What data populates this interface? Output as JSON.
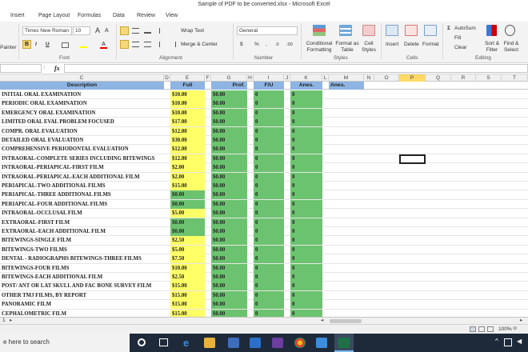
{
  "window": {
    "title": "Sample of PDF to be converted.xlsx  -  Microsoft Excel"
  },
  "menu": [
    "Insert",
    "Page Layout",
    "Formulas",
    "Data",
    "Review",
    "View"
  ],
  "ribbon": {
    "clipboard": {
      "painter": "Painter"
    },
    "font": {
      "name": "Times New Roman",
      "size": "10",
      "label": "Font",
      "grow": "A",
      "shrink": "A",
      "bold": "B",
      "italic": "I",
      "underline": "U"
    },
    "alignment": {
      "wrap": "Wrap Text",
      "merge": "Merge & Center",
      "label": "Alignment"
    },
    "number": {
      "format": "General",
      "currency": "$",
      "percent": "%",
      "comma": ",",
      "inc": ".0",
      "dec": ".00",
      "label": "Number"
    },
    "styles": {
      "conditional": "Conditional Formatting",
      "format_table": "Format as Table",
      "cell_styles": "Cell Styles",
      "label": "Styles"
    },
    "cells": {
      "insert": "Insert",
      "delete": "Delete",
      "format": "Format",
      "label": "Cells"
    },
    "editing": {
      "autosum": "AutoSum",
      "fill": "Fill",
      "clear": "Clear",
      "sort": "Sort & Filter",
      "find": "Find & Select",
      "label": "Editing"
    }
  },
  "formula_bar": {
    "fx": "fx",
    "content": ""
  },
  "columns": [
    "C",
    "D",
    "E",
    "F",
    "G",
    "H",
    "I",
    "J",
    "K",
    "L",
    "M",
    "N",
    "O",
    "P",
    "Q",
    "R",
    "S",
    "T"
  ],
  "headers": {
    "description": "Description",
    "full": "Full",
    "prof": "Prof.",
    "fu": "F/U",
    "anes": "Anes.",
    "anes2": "Anes."
  },
  "rows": [
    {
      "desc": "INITIAL ORAL EXAMINATION",
      "full": "$10.00",
      "prof": "$0.00",
      "fu": "0",
      "anes": "0"
    },
    {
      "desc": "PERIODIC ORAL EXAMINATION",
      "full": "$10.00",
      "prof": "$0.00",
      "fu": "0",
      "anes": "0"
    },
    {
      "desc": "EMERGENCY ORAL EXAMINATION",
      "full": "$10.00",
      "prof": "$0.00",
      "fu": "0",
      "anes": "0"
    },
    {
      "desc": "LIMITED ORAL EVAL PROBLEM FOCUSED",
      "full": "$17.00",
      "prof": "$0.00",
      "fu": "0",
      "anes": "0"
    },
    {
      "desc": "COMPR. ORAL EVALUATION",
      "full": "$12.00",
      "prof": "$0.00",
      "fu": "0",
      "anes": "0"
    },
    {
      "desc": "DETAILED ORAL EVALUATION",
      "full": "$30.00",
      "prof": "$0.00",
      "fu": "0",
      "anes": "0"
    },
    {
      "desc": "COMPREHENSIVE PERIODONTAL EVALUATION",
      "full": "$12.00",
      "prof": "$0.00",
      "fu": "0",
      "anes": "0"
    },
    {
      "desc": "INTRAORAL-COMPLETE SERIES INCLUDING BITEWINGS",
      "full": "$12.00",
      "prof": "$0.00",
      "fu": "0",
      "anes": "0"
    },
    {
      "desc": "INTRAORAL-PERIAPICAL-FIRST FILM",
      "full": "$2.00",
      "prof": "$0.00",
      "fu": "0",
      "anes": "0"
    },
    {
      "desc": "INTRAORAL-PERIAPICAL-EACH ADDITIONAL FILM",
      "full": "$2.00",
      "prof": "$0.00",
      "fu": "0",
      "anes": "0"
    },
    {
      "desc": "PERIAPICAL-TWO ADDITIONAL FILMS",
      "full": "$15.00",
      "prof": "$0.00",
      "fu": "0",
      "anes": "0"
    },
    {
      "desc": "PERIAPICAL-THREE ADDITIONAL FILMS",
      "full": "$0.00",
      "prof": "$0.00",
      "fu": "0",
      "anes": "0",
      "full_green": true
    },
    {
      "desc": "PERIAPICAL-FOUR ADDITIONAL FILMS",
      "full": "$0.00",
      "prof": "$0.00",
      "fu": "0",
      "anes": "0",
      "full_green": true
    },
    {
      "desc": "INTRAORAL-OCCLUSAL FILM",
      "full": "$5.00",
      "prof": "$0.00",
      "fu": "0",
      "anes": "0"
    },
    {
      "desc": "EXTRAORAL-FIRST FILM",
      "full": "$0.00",
      "prof": "$0.00",
      "fu": "0",
      "anes": "0",
      "full_green": true
    },
    {
      "desc": "EXTRAORAL-EACH ADDITIONAL FILM",
      "full": "$0.00",
      "prof": "$0.00",
      "fu": "0",
      "anes": "0",
      "full_green": true
    },
    {
      "desc": "BITEWINGS-SINGLE FILM",
      "full": "$2.50",
      "prof": "$0.00",
      "fu": "0",
      "anes": "0"
    },
    {
      "desc": "BITEWINGS-TWO FILMS",
      "full": "$5.00",
      "prof": "$0.00",
      "fu": "0",
      "anes": "0"
    },
    {
      "desc": "DENTAL - RADIOGRAPHS BITEWINGS-THREE FILMS",
      "full": "$7.50",
      "prof": "$0.00",
      "fu": "0",
      "anes": "0"
    },
    {
      "desc": "BITEWINGS-FOUR FILMS",
      "full": "$10.00",
      "prof": "$0.00",
      "fu": "0",
      "anes": "0"
    },
    {
      "desc": "BITEWINGS-EACH ADDITIONAL FILM",
      "full": "$2.50",
      "prof": "$0.00",
      "fu": "0",
      "anes": "0"
    },
    {
      "desc": "POST/ ANT OR LAT SKULL AND FAC BONE SURVEY FILM",
      "full": "$15.00",
      "prof": "$0.00",
      "fu": "0",
      "anes": "0"
    },
    {
      "desc": "OTHER TMJ FILMS, BY REPORT",
      "full": "$15.00",
      "prof": "$0.00",
      "fu": "0",
      "anes": "0"
    },
    {
      "desc": "PANORAMIC FILM",
      "full": "$15.00",
      "prof": "$0.00",
      "fu": "0",
      "anes": "0"
    },
    {
      "desc": "CEPHALOMETRIC FILM",
      "full": "$15.00",
      "prof": "$0.00",
      "fu": "0",
      "anes": "0"
    }
  ],
  "sheet": {
    "tab_num": "1"
  },
  "status": {
    "zoom": "100%"
  },
  "taskbar": {
    "search": "e here to search"
  },
  "colors": {
    "yellow": "#ffff66",
    "green": "#6cc36f",
    "blue": "#8db4e2",
    "selected_col": "#ffd966"
  }
}
